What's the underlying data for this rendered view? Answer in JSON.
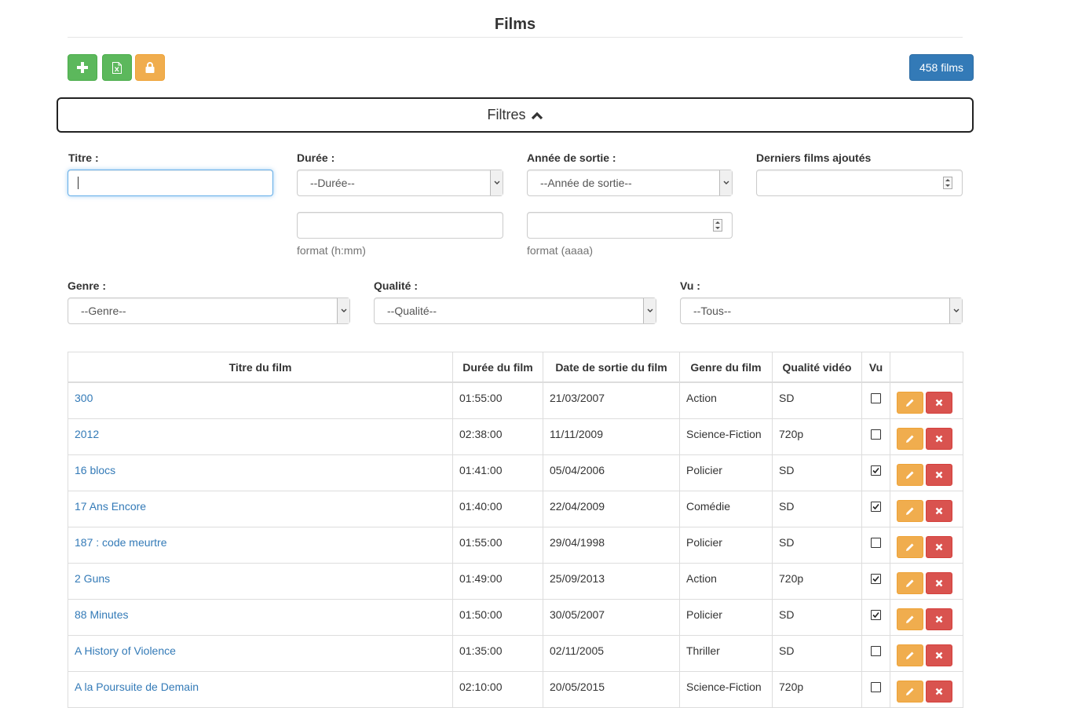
{
  "page": {
    "title": "Films"
  },
  "toolbar": {
    "add_icon": "plus-icon",
    "export_icon": "excel-file-icon",
    "lock_icon": "lock-icon",
    "count_label": "458 films"
  },
  "filters": {
    "toggle_label": "Filtres",
    "toggle_icon": "chevron-up-icon",
    "titre": {
      "label": "Titre :",
      "value": ""
    },
    "duree": {
      "label": "Durée :",
      "select_value": "--Durée--",
      "input_value": "",
      "help": "format (h:mm)"
    },
    "annee": {
      "label": "Année de sortie :",
      "select_value": "--Année de sortie--",
      "input_value": "",
      "help": "format (aaaa)"
    },
    "derniers": {
      "label": "Derniers films ajoutés",
      "value": ""
    },
    "genre": {
      "label": "Genre :",
      "select_value": "--Genre--"
    },
    "qualite": {
      "label": "Qualité :",
      "select_value": "--Qualité--"
    },
    "vu": {
      "label": "Vu :",
      "select_value": "--Tous--"
    }
  },
  "table": {
    "headers": [
      "Titre du film",
      "Durée du film",
      "Date de sortie du film",
      "Genre du film",
      "Qualité vidéo",
      "Vu",
      ""
    ],
    "rows": [
      {
        "title": "300",
        "duration": "01:55:00",
        "release": "21/03/2007",
        "genre": "Action",
        "quality": "SD",
        "seen": false
      },
      {
        "title": "2012",
        "duration": "02:38:00",
        "release": "11/11/2009",
        "genre": "Science-Fiction",
        "quality": "720p",
        "seen": false
      },
      {
        "title": "16 blocs",
        "duration": "01:41:00",
        "release": "05/04/2006",
        "genre": "Policier",
        "quality": "SD",
        "seen": true
      },
      {
        "title": "17 Ans Encore",
        "duration": "01:40:00",
        "release": "22/04/2009",
        "genre": "Comédie",
        "quality": "SD",
        "seen": true
      },
      {
        "title": "187 : code meurtre",
        "duration": "01:55:00",
        "release": "29/04/1998",
        "genre": "Policier",
        "quality": "SD",
        "seen": false
      },
      {
        "title": "2 Guns",
        "duration": "01:49:00",
        "release": "25/09/2013",
        "genre": "Action",
        "quality": "720p",
        "seen": true
      },
      {
        "title": "88 Minutes",
        "duration": "01:50:00",
        "release": "30/05/2007",
        "genre": "Policier",
        "quality": "SD",
        "seen": true
      },
      {
        "title": "A History of Violence",
        "duration": "01:35:00",
        "release": "02/11/2005",
        "genre": "Thriller",
        "quality": "SD",
        "seen": false
      },
      {
        "title": "A la Poursuite de Demain",
        "duration": "02:10:00",
        "release": "20/05/2015",
        "genre": "Science-Fiction",
        "quality": "720p",
        "seen": false
      }
    ]
  },
  "colors": {
    "primary": "#337ab7",
    "success": "#5cb85c",
    "warning": "#f0ad4e",
    "danger": "#d9534f"
  }
}
